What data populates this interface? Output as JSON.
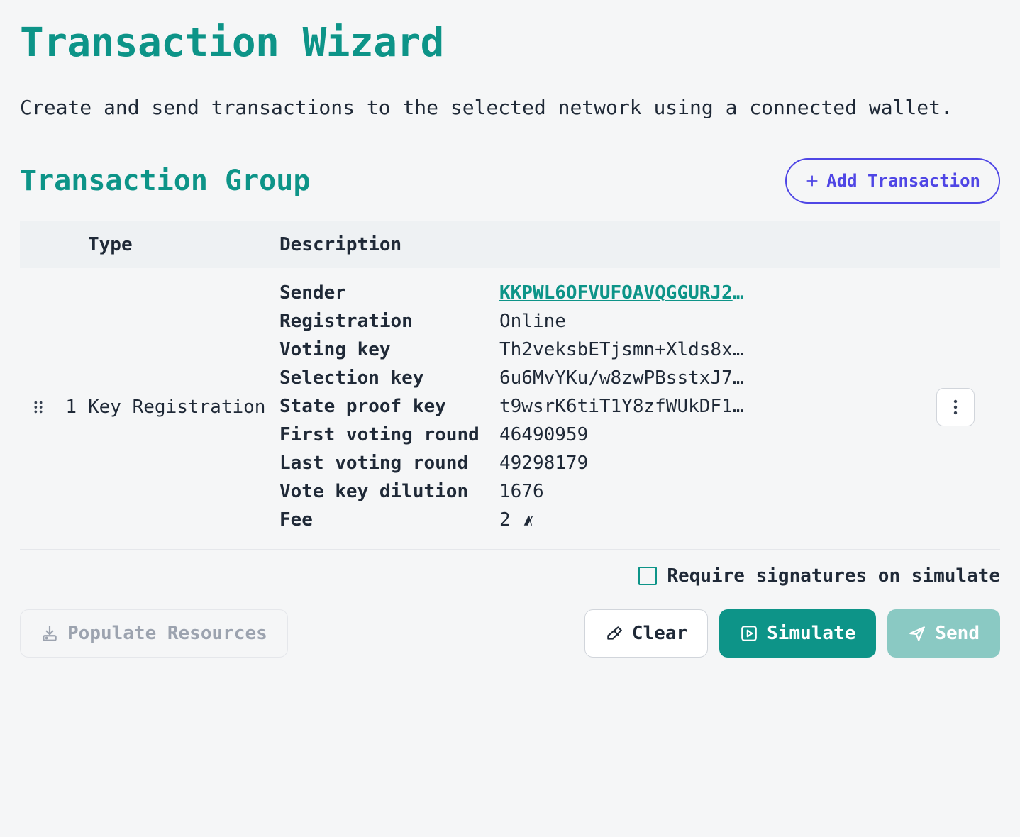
{
  "header": {
    "title": "Transaction Wizard",
    "subtitle": "Create and send transactions to the selected network using a connected wallet."
  },
  "section": {
    "title": "Transaction Group",
    "add_label": "Add Transaction"
  },
  "table": {
    "columns": {
      "type": "Type",
      "description": "Description"
    },
    "row": {
      "index": "1",
      "type": "Key Registration",
      "details": {
        "sender_label": "Sender",
        "sender_value": "KKPWL6OFVUFOAVQGGURJ2EGN…",
        "registration_label": "Registration",
        "registration_value": "Online",
        "voting_key_label": "Voting key",
        "voting_key_value": "Th2veksbETjsmn+Xlds8xGfm…",
        "selection_key_label": "Selection key",
        "selection_key_value": "6u6MvYKu/w8zwPBsstxJ7fkU…",
        "state_proof_key_label": "State proof key",
        "state_proof_key_value": "t9wsrK6tiT1Y8zfWUkDF1V+L…",
        "first_voting_round_label": "First voting round",
        "first_voting_round_value": "46490959",
        "last_voting_round_label": "Last voting round",
        "last_voting_round_value": "49298179",
        "vote_key_dilution_label": "Vote key dilution",
        "vote_key_dilution_value": "1676",
        "fee_label": "Fee",
        "fee_value": "2"
      }
    }
  },
  "checkbox": {
    "label": "Require signatures on simulate",
    "checked": false
  },
  "buttons": {
    "populate_resources": "Populate Resources",
    "clear": "Clear",
    "simulate": "Simulate",
    "send": "Send"
  },
  "colors": {
    "accent": "#0d9488",
    "indigo": "#4f46e5",
    "send_disabled": "#8ac9c3"
  }
}
